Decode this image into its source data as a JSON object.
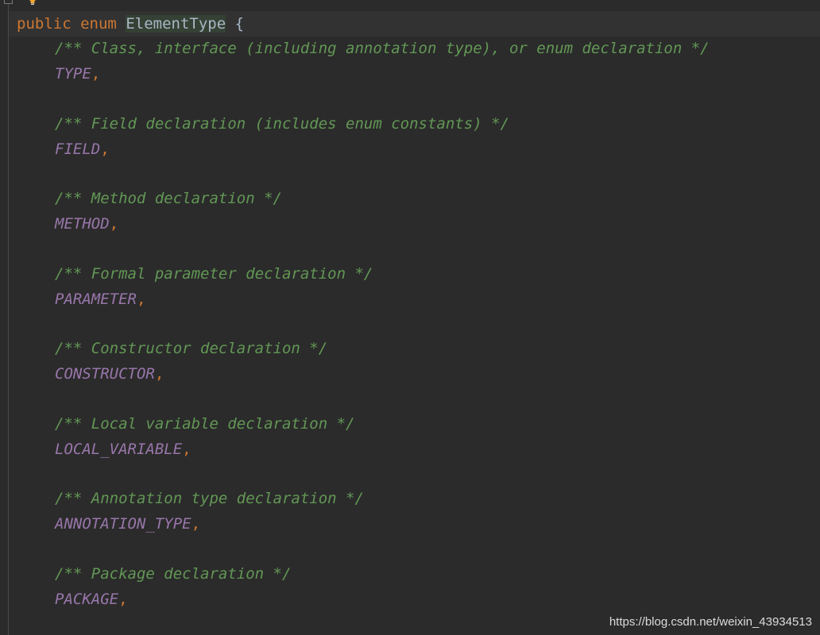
{
  "code": {
    "declaration": {
      "modifier": "public",
      "keyword": "enum",
      "name_first_char": "E",
      "name_rest": "lementType",
      "open_brace": "{"
    },
    "members": [
      {
        "comment": "/** Class, interface (including annotation type), or enum declaration */",
        "constant": "TYPE",
        "separator": ","
      },
      {
        "comment": "/** Field declaration (includes enum constants) */",
        "constant": "FIELD",
        "separator": ","
      },
      {
        "comment": "/** Method declaration */",
        "constant": "METHOD",
        "separator": ","
      },
      {
        "comment": "/** Formal parameter declaration */",
        "constant": "PARAMETER",
        "separator": ","
      },
      {
        "comment": "/** Constructor declaration */",
        "constant": "CONSTRUCTOR",
        "separator": ","
      },
      {
        "comment": "/** Local variable declaration */",
        "constant": "LOCAL_VARIABLE",
        "separator": ","
      },
      {
        "comment": "/** Annotation type declaration */",
        "constant": "ANNOTATION_TYPE",
        "separator": ","
      },
      {
        "comment": "/** Package declaration */",
        "constant": "PACKAGE",
        "separator": ","
      }
    ]
  },
  "watermark": "https://blog.csdn.net/weixin_43934513",
  "icons": {
    "fold": "fold-marker-icon",
    "intention": "lightbulb-icon"
  },
  "colors": {
    "background": "#2b2b2b",
    "keyword": "#cc7832",
    "comment": "#629755",
    "constant": "#9876aa",
    "identifier": "#a9b7c6"
  }
}
